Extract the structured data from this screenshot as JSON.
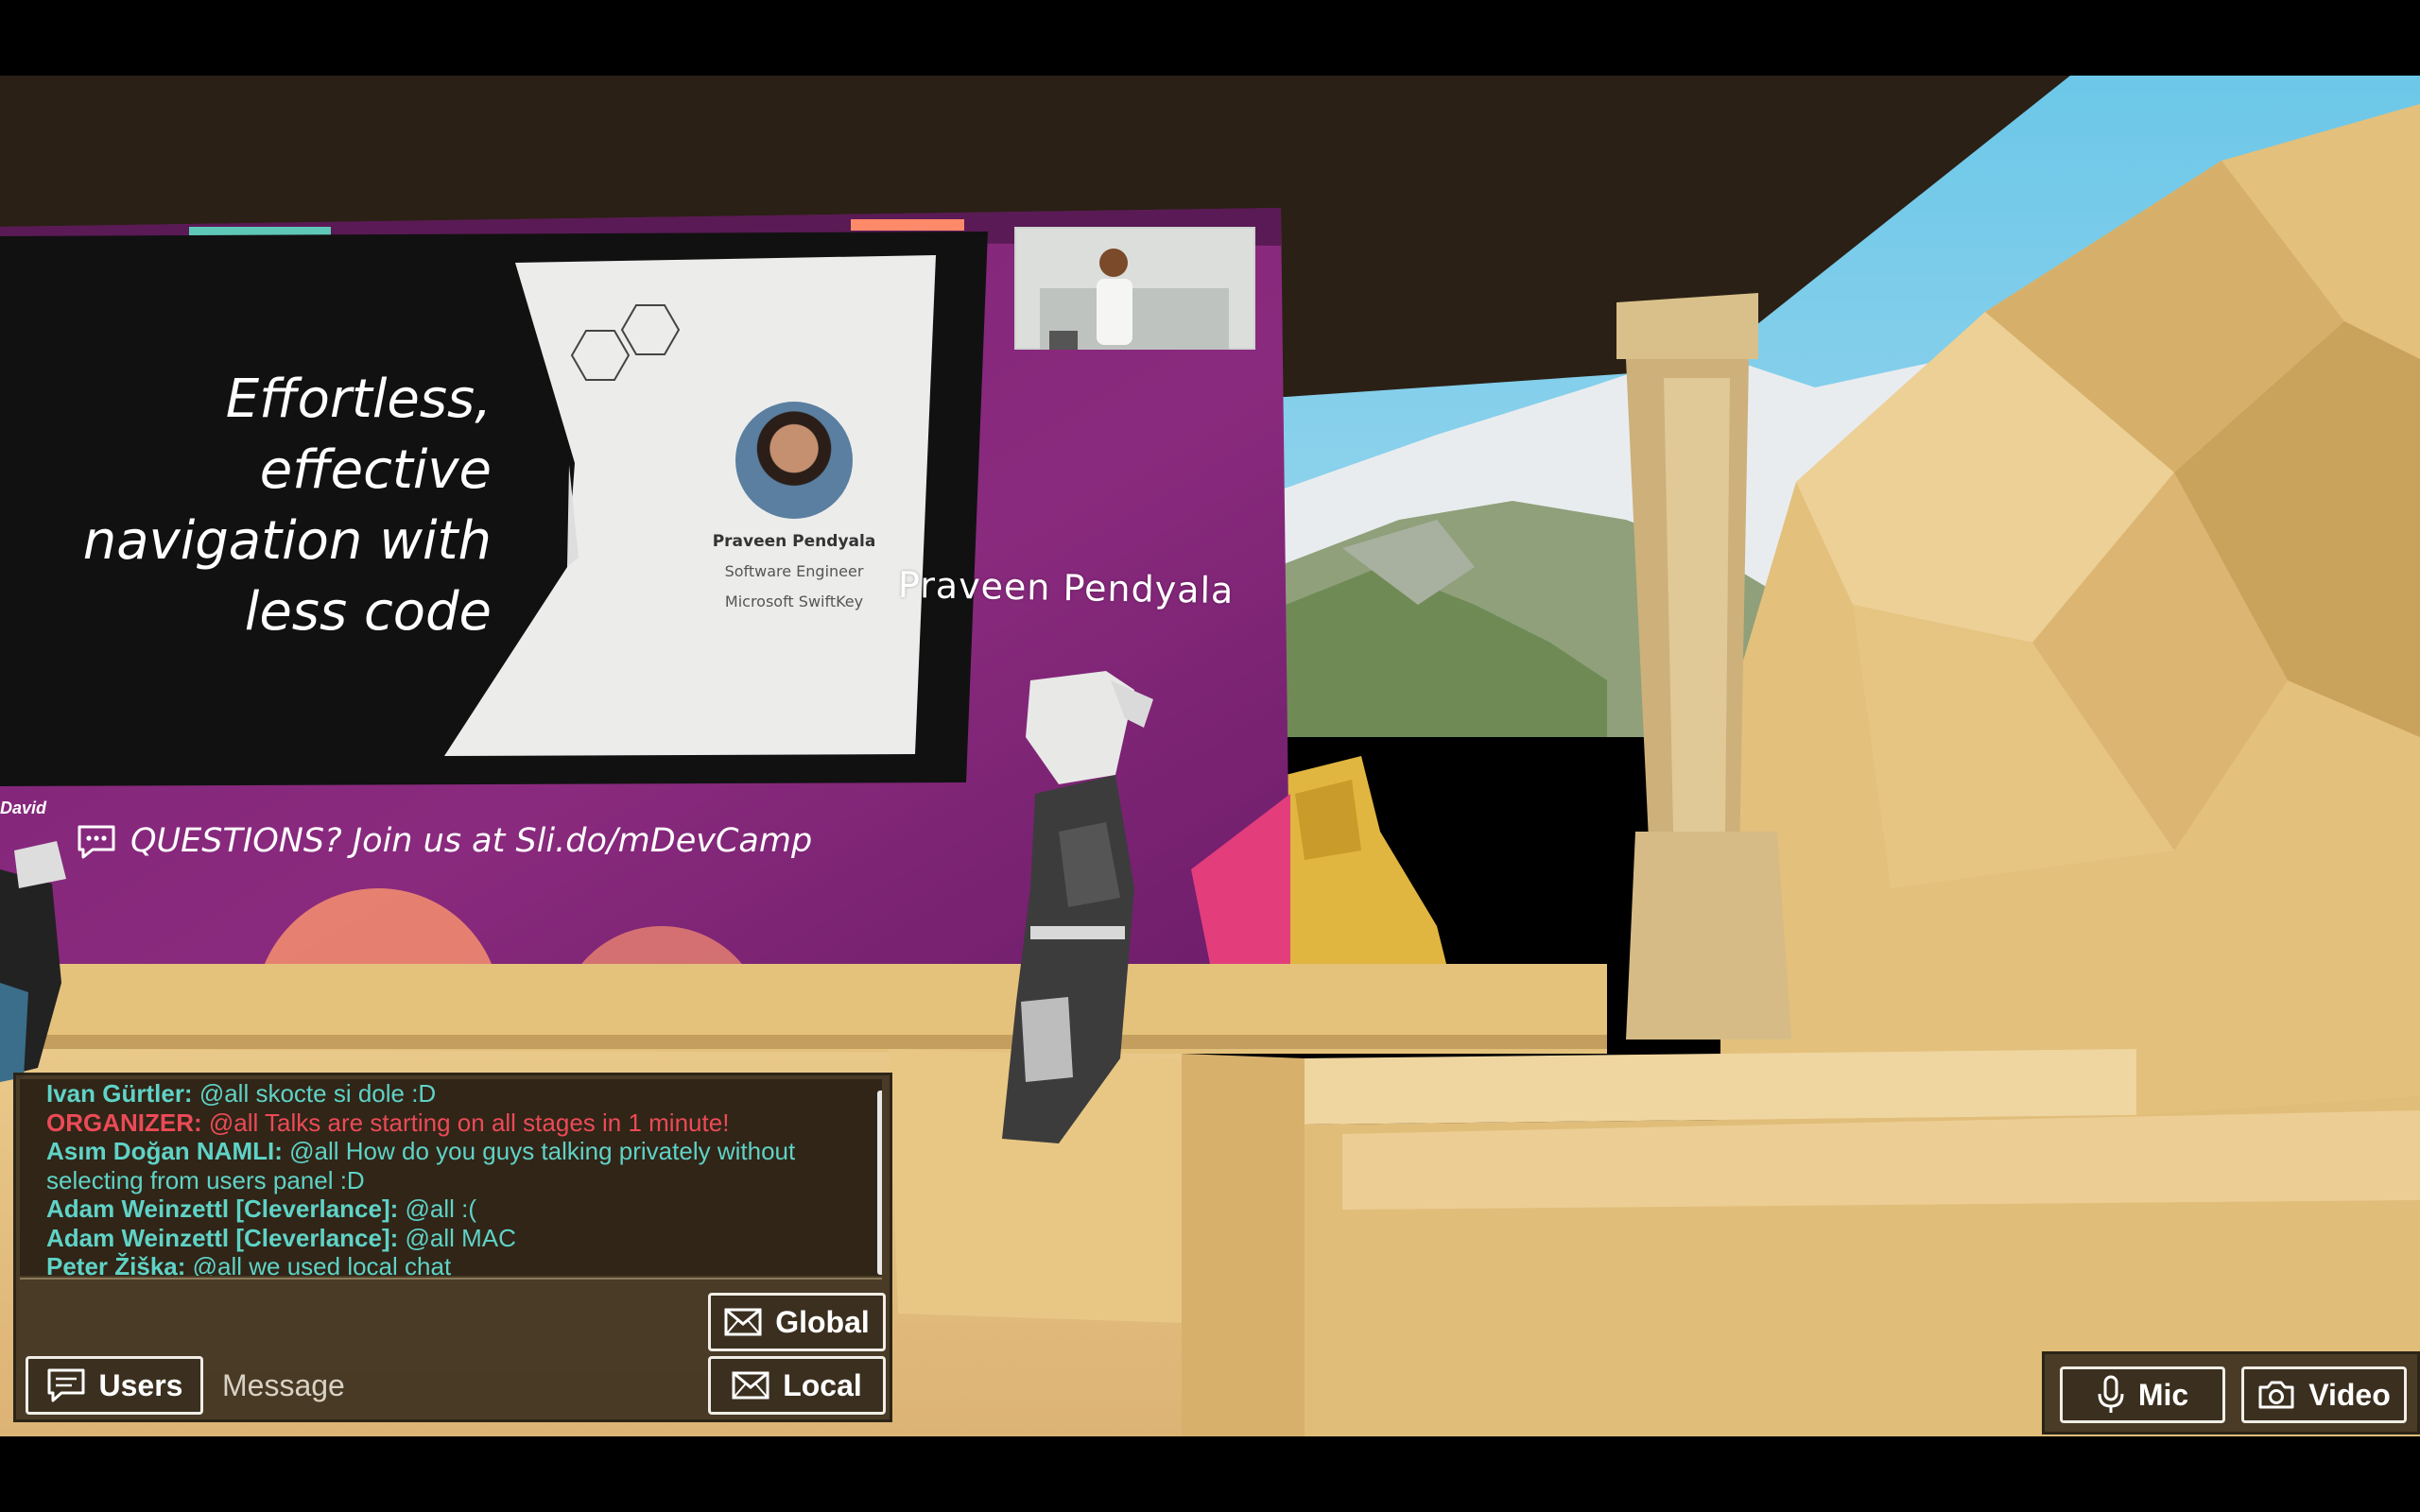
{
  "slide": {
    "title_lines": [
      "Effortless,",
      "effective",
      "navigation with",
      "less code"
    ],
    "speaker_name": "Praveen Pendyala",
    "speaker_role": "Software Engineer",
    "speaker_company": "Microsoft SwiftKey",
    "questions_banner": "QUESTIONS? Join us at Sli.do/mDevCamp"
  },
  "presenter_label": "Praveen Pendyala",
  "avatar_name": "David",
  "chat": {
    "messages": [
      {
        "user": "Ivan Gürtler:",
        "text": " @all skocte si dole :D",
        "type": "user"
      },
      {
        "user": "ORGANIZER:",
        "text": " @all  Talks are starting on all stages in 1 minute!",
        "type": "organizer"
      },
      {
        "user": "Asım Doğan NAMLI:",
        "text": " @all How do you guys talking privately without",
        "type": "user"
      },
      {
        "user": "",
        "text": "selecting from users panel :D",
        "type": "continuation"
      },
      {
        "user": "Adam Weinzettl [Cleverlance]:",
        "text": " @all :(",
        "type": "user"
      },
      {
        "user": "Adam Weinzettl [Cleverlance]:",
        "text": " @all MAC",
        "type": "user"
      },
      {
        "user": "Peter Žiška:",
        "text": " @all we used local chat",
        "type": "user"
      }
    ],
    "global_label": "Global",
    "local_label": "Local",
    "users_label": "Users",
    "message_placeholder": "Message"
  },
  "media": {
    "mic_label": "Mic",
    "video_label": "Video"
  },
  "colors": {
    "chat_user": "#5fd3c7",
    "organizer": "#ec4a57",
    "panel_bg": "#403422",
    "stage_purple": "#8a2a7e"
  }
}
